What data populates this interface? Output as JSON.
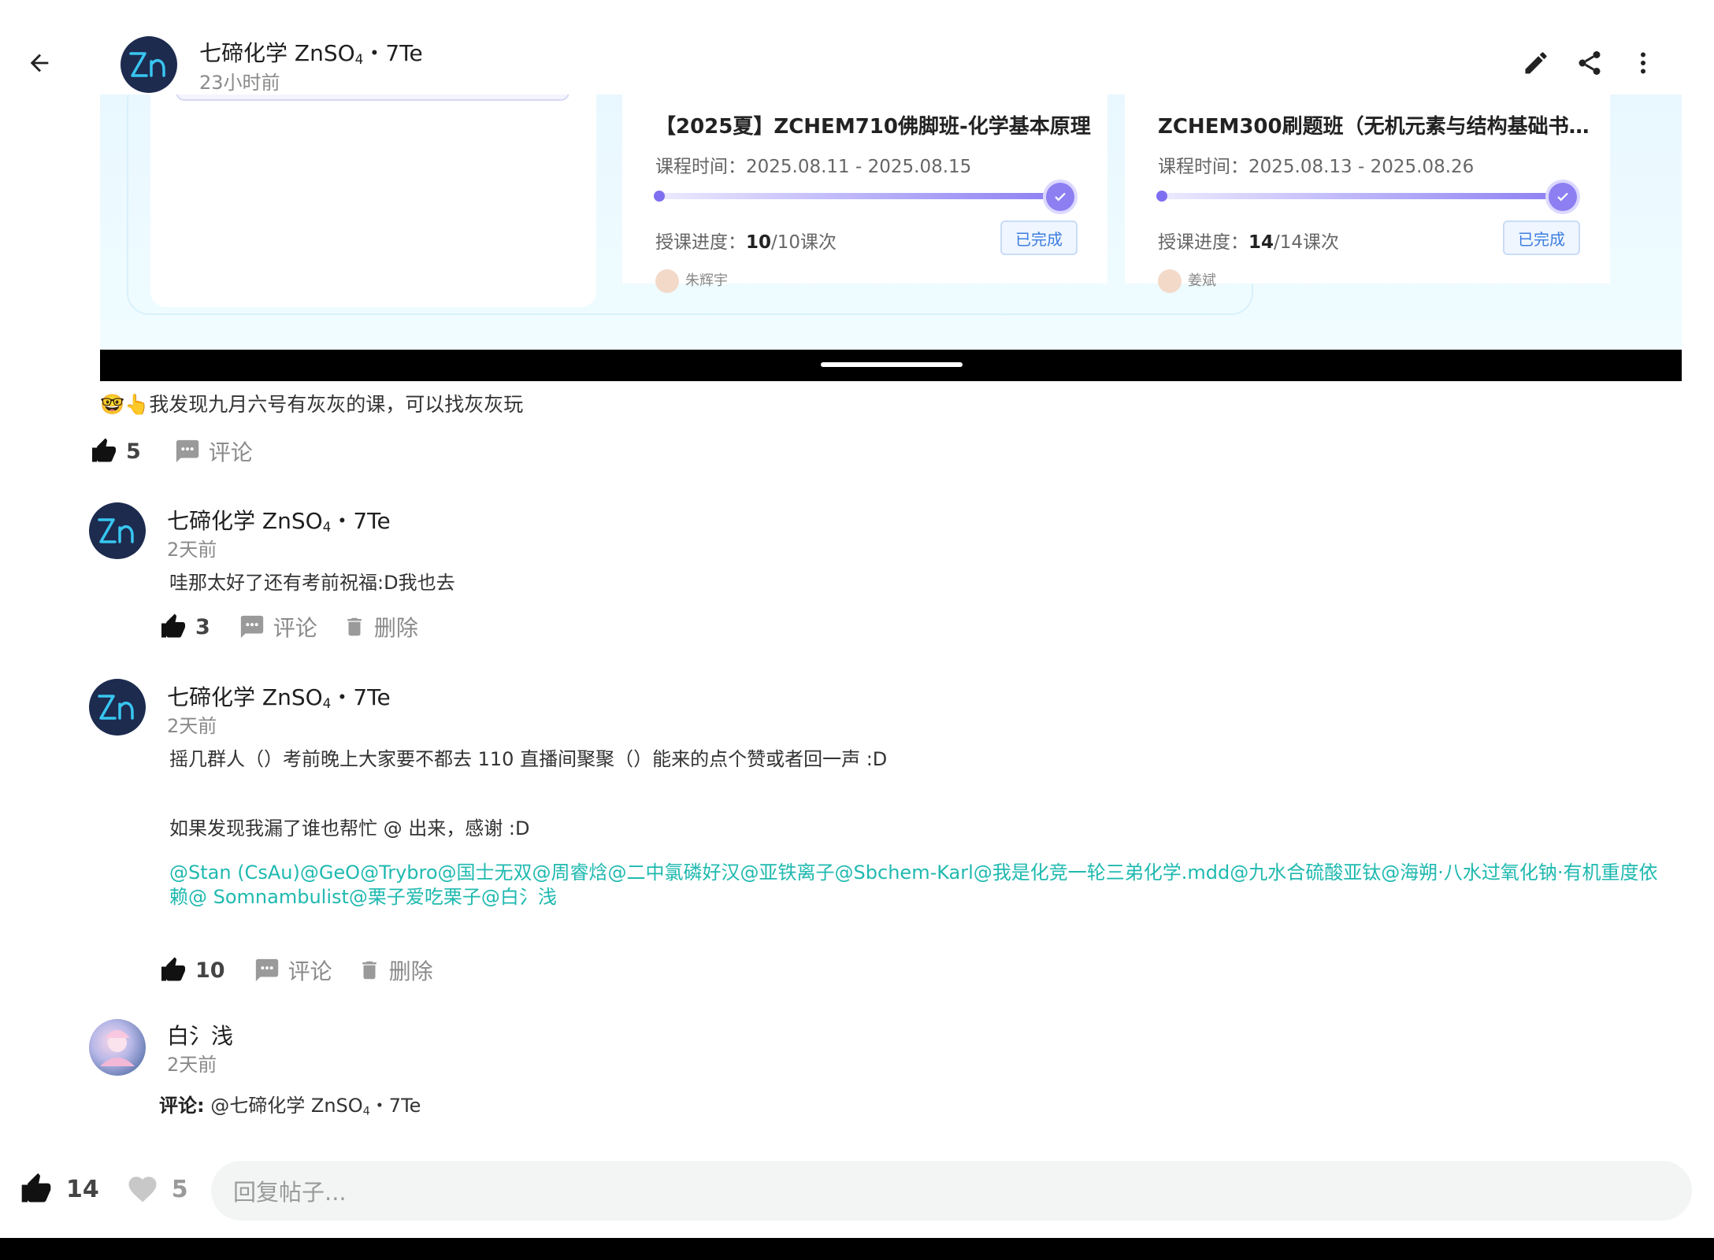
{
  "header": {
    "author_name_prefix": "七碲化学 ZnSO",
    "author_name_sub": "4",
    "author_name_suffix": "・7Te",
    "time": "23小时前",
    "icons": [
      "arrow-left-icon",
      "pencil-icon",
      "share-icon",
      "more-vert-icon"
    ]
  },
  "screenshot": {
    "cards": [
      {
        "title": "【2025夏】ZCHEM710佛脚班-化学基本原理",
        "time_label": "课程时间：",
        "time_value": "2025.08.11 - 2025.08.15",
        "progress_label": "授课进度：",
        "progress_done": "10",
        "progress_total": "/10课次",
        "progress_fraction": 1.0,
        "badge": "已完成",
        "teacher": "朱辉宇"
      },
      {
        "title": "ZCHEM300刷题班（无机元素与结构基础书…",
        "time_label": "课程时间：",
        "time_value": "2025.08.13 - 2025.08.26",
        "progress_label": "授课进度：",
        "progress_done": "14",
        "progress_total": "/14课次",
        "progress_fraction": 1.0,
        "badge": "已完成",
        "teacher": "姜斌"
      }
    ]
  },
  "post": {
    "text": "🤓👆我发现九月六号有灰灰的课，可以找灰灰玩",
    "likes": "5",
    "comment_label": "评论"
  },
  "comments": [
    {
      "author_prefix": "七碲化学 ZnSO",
      "author_sub": "4",
      "author_suffix": "・7Te",
      "time": "2天前",
      "body": "哇那太好了还有考前祝福:D我也去",
      "likes": "3",
      "comment_label": "评论",
      "delete_label": "删除"
    },
    {
      "author_prefix": "七碲化学 ZnSO",
      "author_sub": "4",
      "author_suffix": "・7Te",
      "time": "2天前",
      "body_line1": "摇几群人（）考前晚上大家要不都去 110 直播间聚聚（）能来的点个赞或者回一声 :D",
      "body_line2": "如果发现我漏了谁也帮忙 @ 出来，感谢 :D",
      "mentions": [
        "@Stan (CsAu)",
        "@GeO",
        "@Trybro",
        "@国士无双",
        "@周睿焓",
        "@二中氯磷好汉",
        "@亚铁离子",
        "@Sbchem-Karl",
        "@我是化竞一轮三弟化学.mdd",
        "@九水合硫酸亚钛",
        "@海朔·八水过氧化钠·有机重度依赖",
        "@ Somnambulist",
        "@栗子爱吃栗子",
        "@白氵浅"
      ],
      "likes": "10",
      "comment_label": "评论",
      "delete_label": "删除"
    },
    {
      "author": "白氵浅",
      "time": "2天前",
      "reply_label": "评论:",
      "reply_target_prefix": "@七碲化学 ZnSO",
      "reply_target_sub": "4",
      "reply_target_suffix": "・7Te"
    }
  ],
  "bottom": {
    "likes": "14",
    "hearts": "5",
    "reply_placeholder": "回复帖子..."
  },
  "colors": {
    "mention": "#1fb9b0",
    "progress": "#8d7ff2",
    "badge": "#3d7ee0"
  }
}
